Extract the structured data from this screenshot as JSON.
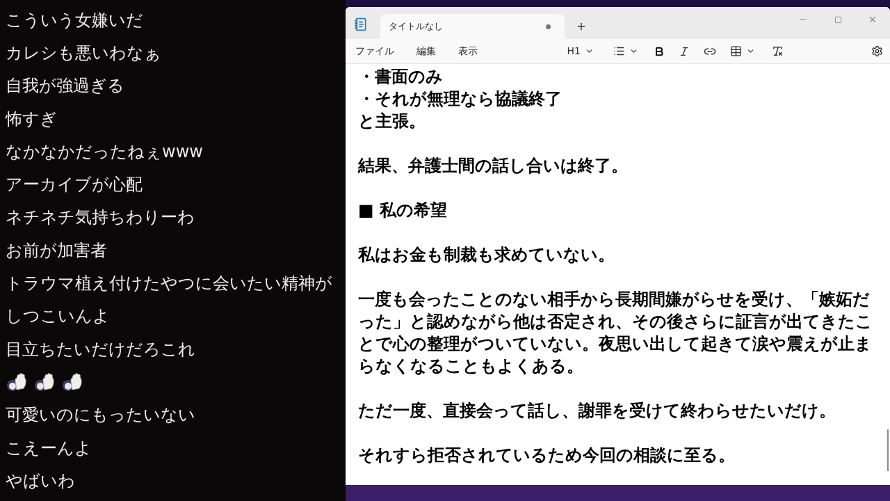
{
  "chat": {
    "messages": [
      {
        "kind": "text",
        "text": "こういう女嫌いだ"
      },
      {
        "kind": "text",
        "text": "カレシも悪いわなぁ"
      },
      {
        "kind": "text",
        "text": "自我が強過ぎる"
      },
      {
        "kind": "text",
        "text": "怖すぎ"
      },
      {
        "kind": "text",
        "text": "なかなかだったねぇwww"
      },
      {
        "kind": "text",
        "text": "アーカイブが心配"
      },
      {
        "kind": "text",
        "text": "ネチネチ気持ちわりーわ"
      },
      {
        "kind": "text",
        "text": "お前が加害者"
      },
      {
        "kind": "text",
        "text": "トラウマ植え付けたやつに会いたい精神が"
      },
      {
        "kind": "text",
        "text": "しつこいんよ"
      },
      {
        "kind": "text",
        "text": "目立ちたいだけだろこれ"
      },
      {
        "kind": "emotes"
      },
      {
        "kind": "text",
        "text": "可愛いのにもったいない"
      },
      {
        "kind": "text",
        "text": "こえーんよ"
      },
      {
        "kind": "text",
        "text": "やばいわ"
      }
    ]
  },
  "notepad": {
    "tab": {
      "title": "タイトルなし",
      "modified": true
    },
    "menu": [
      "ファイル",
      "編集",
      "表示"
    ],
    "heading_level": "H1",
    "paragraphs": [
      [
        "・書面のみ",
        "・それが無理なら協議終了",
        "と主張。"
      ],
      [
        "結果、弁護士間の話し合いは終了。"
      ],
      [
        "■ 私の希望"
      ],
      [
        "私はお金も制裁も求めていない。"
      ],
      [
        "一度も会ったことのない相手から長期間嫌がらせを受け、「嫉妬だった」と認めながら他は否定され、その後さらに証言が出てきたことで心の整理がついていない。夜思い出して起きて涙や震えが止まらなくなることもよくある。"
      ],
      [
        "ただ一度、直接会って話し、謝罪を受けて終わらせたいだけ。"
      ],
      [
        "それすら拒否されているため今回の相談に至る。"
      ]
    ]
  }
}
